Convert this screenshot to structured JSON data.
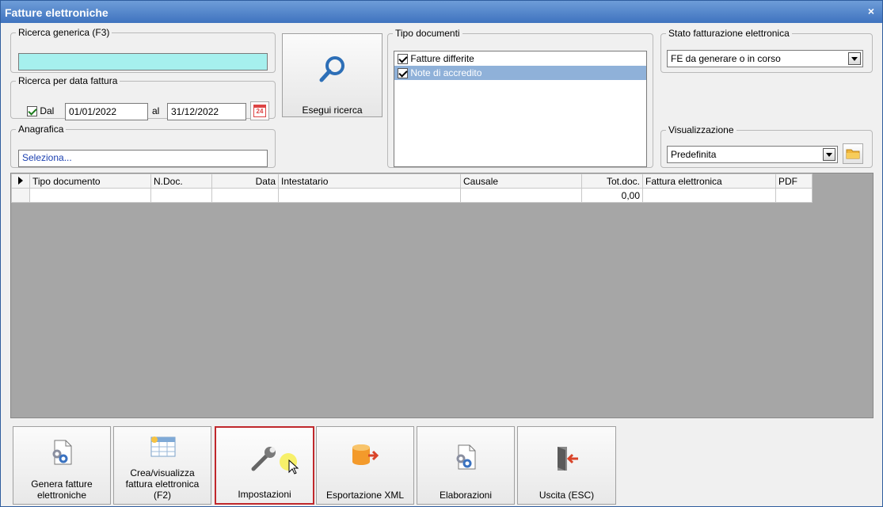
{
  "window": {
    "title": "Fatture elettroniche",
    "close": "×"
  },
  "search_generic": {
    "legend": "Ricerca generica (F3)",
    "value": ""
  },
  "search_date": {
    "legend": "Ricerca per data fattura",
    "from_label": "Dal",
    "from_value": "01/01/2022",
    "to_label": "al",
    "to_value": "31/12/2022",
    "calendar_text": "24"
  },
  "anagrafica": {
    "legend": "Anagrafica",
    "placeholder": "Seleziona..."
  },
  "search_button": {
    "label": "Esegui ricerca"
  },
  "doc_types": {
    "legend": "Tipo documenti",
    "items": [
      {
        "label": "Fatture differite",
        "checked": true
      },
      {
        "label": "Note di accredito",
        "checked": true
      }
    ]
  },
  "fe_status": {
    "legend": "Stato fatturazione elettronica",
    "selected": "FE da generare o in corso"
  },
  "view": {
    "legend": "Visualizzazione",
    "selected": "Predefinita"
  },
  "grid": {
    "columns": [
      "Tipo documento",
      "N.Doc.",
      "Data",
      "Intestatario",
      "Causale",
      "Tot.doc.",
      "Fattura elettronica",
      "PDF"
    ],
    "rows": [
      [
        "",
        "",
        "",
        "",
        "",
        "0,00",
        "",
        ""
      ]
    ]
  },
  "buttons": [
    {
      "label": "Genera fatture elettroniche",
      "icon": "gear-document-icon"
    },
    {
      "label": "Crea/visualizza fattura elettronica (F2)",
      "icon": "table-sun-icon"
    },
    {
      "label": "Impostazioni",
      "icon": "wrench-icon"
    },
    {
      "label": "Esportazione XML",
      "icon": "database-export-icon"
    },
    {
      "label": "Elaborazioni",
      "icon": "gear-document-icon"
    },
    {
      "label": "Uscita (ESC)",
      "icon": "exit-door-icon"
    }
  ],
  "colors": {
    "title_bar": "#4a7ec8",
    "search_field": "#a6f0ee",
    "selected_row": "#8fb1d9",
    "active_button_border": "#c0282c",
    "grid_background": "#a6a6a6"
  }
}
